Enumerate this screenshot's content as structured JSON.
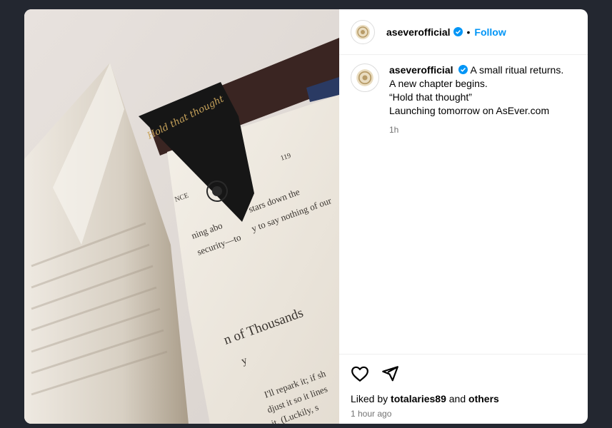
{
  "post": {
    "username": "aseverofficial",
    "follow_label": "Follow",
    "dot": "•",
    "caption_lines": [
      "A small ritual returns.",
      "A new chapter begins.",
      "“Hold that thought”",
      "Launching tomorrow on AsEver.com"
    ],
    "caption_age": "1h",
    "liked_prefix": "Liked by",
    "liked_user": "totalaries89",
    "liked_and": "and",
    "liked_others": "others",
    "timestamp": "1 hour ago"
  },
  "image": {
    "bookmark_text": "Hold that thought",
    "page_number": "119",
    "line_1": "stars down the",
    "line_2": "ning abo",
    "line_3": "y to say nothing of our",
    "line_4": "security—to",
    "line_5": "NCE",
    "chapter_title": "n of Thousands",
    "chapter_sub": "y",
    "line_6": "I'll repark it; if sh",
    "line_7": "djust it so it lines",
    "line_8": "it. (Luckily, s"
  },
  "colors": {
    "accent": "#0095f6",
    "verified": "#0095f6",
    "modal_bg": "#ffffff",
    "page_bg": "#232730"
  },
  "icons": {
    "like": "heart-icon",
    "share": "paper-plane-icon",
    "verified": "verified-badge-icon"
  }
}
